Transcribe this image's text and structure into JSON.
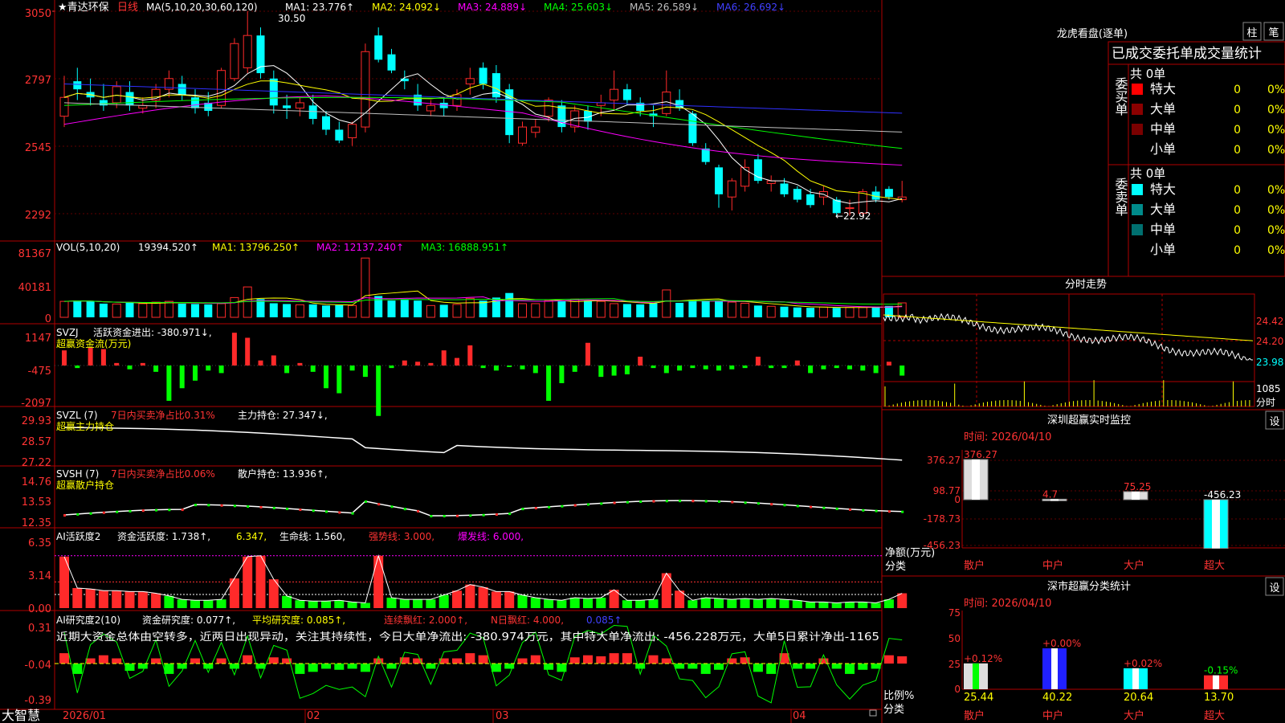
{
  "stock": {
    "name": "★青达环保",
    "period": "日线",
    "ma_header": "MA(5,10,20,30,60,120)",
    "ma": [
      {
        "label": "MA1: 23.776↑",
        "color": "#ffffff"
      },
      {
        "label": "MA2: 24.092↓",
        "color": "#ffff00"
      },
      {
        "label": "MA3: 24.889↓",
        "color": "#ff00ff"
      },
      {
        "label": "MA4: 25.603↓",
        "color": "#00ff00"
      },
      {
        "label": "MA5: 26.589↓",
        "color": "#c0c0c0"
      },
      {
        "label": "MA6: 26.692↓",
        "color": "#0000ff"
      }
    ],
    "high_mark": "30.50",
    "low_mark": "←22.92",
    "y_ticks": [
      "3050",
      "2797",
      "2545",
      "2292"
    ]
  },
  "volume": {
    "header": "VOL(5,10,20)",
    "value": "19394.520↑",
    "ma": [
      {
        "label": "MA1: 13796.250↑",
        "color": "#ffff00"
      },
      {
        "label": "MA2: 12137.240↑",
        "color": "#ff00ff"
      },
      {
        "label": "MA3: 16888.951↑",
        "color": "#00ff00"
      }
    ],
    "y_ticks": [
      "81367",
      "40181",
      "0"
    ]
  },
  "svzj": {
    "header": "SVZJ",
    "text": "活跃资金进出: -380.971↓,",
    "subtitle": "超赢资金流(万元)",
    "y_ticks": [
      "1147",
      "-475",
      "-2097"
    ]
  },
  "svzl": {
    "header": "SVZL (7)",
    "text1": "7日内买卖净占比0.31%",
    "text2": "主力持仓: 27.347↓,",
    "subtitle": "超赢主力持仓",
    "y_ticks": [
      "29.93",
      "28.57",
      "27.22"
    ]
  },
  "svsh": {
    "header": "SVSH (7)",
    "text1": "7日内买卖净占比0.06%",
    "text2": "散户持仓: 13.936↑,",
    "subtitle": "超赢散户持仓",
    "y_ticks": [
      "14.76",
      "13.53",
      "12.35"
    ]
  },
  "ai_active": {
    "header": "AI活跃度2",
    "t1": "资金活跃度: 1.738↑,",
    "t2": "6.347,",
    "t3": "生命线: 1.560,",
    "t4": "强势线: 3.000,",
    "t5": "爆发线: 6.000,",
    "y_ticks": [
      "6.35",
      "3.14",
      "0.00"
    ]
  },
  "ai_research": {
    "header": "AI研究度2(10)",
    "t1": "资金研究度: 0.077↑,",
    "t2": "平均研究度: 0.085↑,",
    "t3": "连续飘红: 2.000↑,",
    "t4": "N日飘红: 4.000,",
    "t5": "0.085↑",
    "comment": "近期大资金总体由空转多，近两日出现异动，关注其持续性，今日大单净流出: -380.974万元，其中特大单净流出: -456.228万元，大单5日累计净出-1165",
    "y_ticks": [
      "0.31",
      "-0.04",
      "-0.39"
    ]
  },
  "date_axis": {
    "brand": "大智慧",
    "labels": [
      "2026/01",
      "02",
      "03",
      "04"
    ]
  },
  "right": {
    "lhkp_title": "龙虎看盘(逐单)",
    "tab1": "柱",
    "tab2": "笔",
    "order_header": "已成交委托单成交量统计",
    "buy_label": "委买单",
    "sell_label": "委卖单",
    "buy_total": "共 0单",
    "sell_total": "共 0单",
    "buy_rows": [
      {
        "label": "特大",
        "count": "0",
        "pct": "0%",
        "color": "#ff0000"
      },
      {
        "label": "大单",
        "count": "0",
        "pct": "0%",
        "color": "#8b0000"
      },
      {
        "label": "中单",
        "count": "0",
        "pct": "0%",
        "color": "#7a0000"
      },
      {
        "label": "小单",
        "count": "0",
        "pct": "0%",
        "color": "#000000"
      }
    ],
    "sell_rows": [
      {
        "label": "特大",
        "count": "0",
        "pct": "0%",
        "color": "#00ffff"
      },
      {
        "label": "大单",
        "count": "0",
        "pct": "0%",
        "color": "#008b8b"
      },
      {
        "label": "中单",
        "count": "0",
        "pct": "0%",
        "color": "#007070"
      },
      {
        "label": "小单",
        "count": "0",
        "pct": "0%",
        "color": "#000000"
      }
    ],
    "intraday_title": "分时走势",
    "intraday_prices": [
      "24.42",
      "24.20",
      "23.98"
    ],
    "intraday_vol": "1085",
    "intraday_unit": "分时",
    "sz_title": "深圳超赢实时监控",
    "settings": "设",
    "sz_date": "时间: 2026/04/10",
    "sz_y_ticks": [
      "376.27",
      "98.77",
      "0",
      "-178.73",
      "-456.23"
    ],
    "sz_ylabel1": "净额(万元)",
    "sz_ylabel2": "分类",
    "sz_bars": [
      {
        "cat": "散户",
        "value": 376.27,
        "label": "376.27"
      },
      {
        "cat": "中户",
        "value": 4.7,
        "label": "4.7"
      },
      {
        "cat": "大户",
        "value": 75.25,
        "label": "75.25"
      },
      {
        "cat": "超大",
        "value": -456.23,
        "label": "-456.23"
      }
    ],
    "cls_title": "深市超赢分类统计",
    "cls_date": "时间: 2026/04/10",
    "cls_y_ticks": [
      "75",
      "50",
      "25",
      "0"
    ],
    "cls_ylabel1": "比例%",
    "cls_ylabel2": "分类",
    "cls_bars": [
      {
        "cat": "散户",
        "value": 25.44,
        "label": "25.44",
        "chg": "+0.12%"
      },
      {
        "cat": "中户",
        "value": 40.22,
        "label": "40.22",
        "chg": "+0.00%"
      },
      {
        "cat": "大户",
        "value": 20.64,
        "label": "20.64",
        "chg": "+0.02%"
      },
      {
        "cat": "超大",
        "value": 13.7,
        "label": "13.70",
        "chg": "-0.15%"
      }
    ]
  },
  "chart_data": [
    {
      "type": "candlestick",
      "title": "青达环保 日线",
      "ylim": [
        22.92,
        30.5
      ],
      "ohlc": [
        [
          26.6,
          28.1,
          26.2,
          27.3
        ],
        [
          27.9,
          28.4,
          27.2,
          27.6
        ],
        [
          27.5,
          28.0,
          27.0,
          27.3
        ],
        [
          27.2,
          27.8,
          26.8,
          27.0
        ],
        [
          27.1,
          27.9,
          26.9,
          27.7
        ],
        [
          27.5,
          27.9,
          26.8,
          27.0
        ],
        [
          26.9,
          27.3,
          26.7,
          27.0
        ],
        [
          27.2,
          27.8,
          26.9,
          27.6
        ],
        [
          27.6,
          28.3,
          27.3,
          28.0
        ],
        [
          27.8,
          28.1,
          27.2,
          27.4
        ],
        [
          27.3,
          27.6,
          26.7,
          26.9
        ],
        [
          27.1,
          27.5,
          26.6,
          26.8
        ],
        [
          27.0,
          28.4,
          26.9,
          28.3
        ],
        [
          28.0,
          29.5,
          27.9,
          29.3
        ],
        [
          28.4,
          30.5,
          28.2,
          29.6
        ],
        [
          29.6,
          29.9,
          28.0,
          28.2
        ],
        [
          28.0,
          28.3,
          26.7,
          27.0
        ],
        [
          27.0,
          27.4,
          26.5,
          26.9
        ],
        [
          26.9,
          27.3,
          26.6,
          27.1
        ],
        [
          27.0,
          27.4,
          26.3,
          26.5
        ],
        [
          26.6,
          26.8,
          25.9,
          26.1
        ],
        [
          26.1,
          26.4,
          25.6,
          25.7
        ],
        [
          25.8,
          26.4,
          25.5,
          26.3
        ],
        [
          26.2,
          29.3,
          26.0,
          29.0
        ],
        [
          29.6,
          29.9,
          28.6,
          28.7
        ],
        [
          28.9,
          29.1,
          28.2,
          28.3
        ],
        [
          28.0,
          28.3,
          27.6,
          27.9
        ],
        [
          27.4,
          27.8,
          26.8,
          27.0
        ],
        [
          26.8,
          27.2,
          26.6,
          27.0
        ],
        [
          27.1,
          27.3,
          26.6,
          26.9
        ],
        [
          27.0,
          27.6,
          26.8,
          27.4
        ],
        [
          27.8,
          28.4,
          27.4,
          28.0
        ],
        [
          28.4,
          28.6,
          27.6,
          27.8
        ],
        [
          28.2,
          28.5,
          27.1,
          27.3
        ],
        [
          27.6,
          27.8,
          25.6,
          25.9
        ],
        [
          25.6,
          26.4,
          25.5,
          26.2
        ],
        [
          26.0,
          26.5,
          25.8,
          26.2
        ],
        [
          26.6,
          27.3,
          26.4,
          27.2
        ],
        [
          27.0,
          27.2,
          26.0,
          26.2
        ],
        [
          26.2,
          27.0,
          26.0,
          26.8
        ],
        [
          26.8,
          27.0,
          26.1,
          26.4
        ],
        [
          27.0,
          27.4,
          26.6,
          27.1
        ],
        [
          27.2,
          28.3,
          26.8,
          27.6
        ],
        [
          27.6,
          27.8,
          27.0,
          27.2
        ],
        [
          27.1,
          27.3,
          26.6,
          26.8
        ],
        [
          26.7,
          27.0,
          26.2,
          26.6
        ],
        [
          26.7,
          28.3,
          26.6,
          27.5
        ],
        [
          27.2,
          27.6,
          26.8,
          26.9
        ],
        [
          26.7,
          26.8,
          25.5,
          25.6
        ],
        [
          25.4,
          25.6,
          24.8,
          24.9
        ],
        [
          24.7,
          24.8,
          23.2,
          23.7
        ],
        [
          23.6,
          24.3,
          23.1,
          24.2
        ],
        [
          24.0,
          25.0,
          23.8,
          24.7
        ],
        [
          25.0,
          25.2,
          24.1,
          24.2
        ],
        [
          24.1,
          24.4,
          23.8,
          24.2
        ],
        [
          24.1,
          24.3,
          23.6,
          23.7
        ],
        [
          23.9,
          24.0,
          23.4,
          23.5
        ],
        [
          23.7,
          23.9,
          23.2,
          23.3
        ],
        [
          23.6,
          24.0,
          23.3,
          23.8
        ],
        [
          23.5,
          23.6,
          22.9,
          23.0
        ],
        [
          23.2,
          23.5,
          22.9,
          23.2
        ],
        [
          23.0,
          23.9,
          22.9,
          23.8
        ],
        [
          23.8,
          24.0,
          23.4,
          23.5
        ],
        [
          23.9,
          24.0,
          23.5,
          23.6
        ],
        [
          23.5,
          24.2,
          23.4,
          23.6
        ]
      ]
    },
    {
      "type": "bar",
      "title": "VOL",
      "values": [
        21000,
        22000,
        21000,
        18000,
        17500,
        19000,
        18000,
        20000,
        21000,
        18000,
        17500,
        17000,
        18000,
        26000,
        40000,
        24000,
        18500,
        17500,
        16500,
        17000,
        15500,
        16000,
        15500,
        78000,
        28000,
        22000,
        23000,
        22000,
        15500,
        16500,
        17000,
        25000,
        22000,
        26000,
        32000,
        18000,
        18000,
        22000,
        21000,
        24000,
        22000,
        21000,
        18000,
        17500,
        17000,
        18500,
        36000,
        19000,
        23000,
        22000,
        21000,
        20000,
        18500,
        15500,
        14500,
        14000,
        13000,
        12500,
        13500,
        12500,
        13000,
        13000,
        14000,
        15000,
        19000
      ]
    },
    {
      "type": "bar",
      "title": "超赢资金流(万元)",
      "values": [
        600,
        -100,
        700,
        650,
        100,
        -150,
        100,
        -250,
        -1400,
        -900,
        -600,
        -200,
        -300,
        1300,
        1100,
        200,
        400,
        -300,
        100,
        -250,
        -900,
        -1100,
        -200,
        -450,
        -2000,
        -100,
        200,
        150,
        100,
        600,
        300,
        800,
        -100,
        -200,
        -50,
        -150,
        -300,
        -1400,
        -700,
        -250,
        900,
        -450,
        -400,
        -350,
        350,
        -100,
        -300,
        -200,
        -100,
        -150,
        -200,
        -150,
        -100,
        350,
        -100,
        -100,
        200,
        -300,
        -150,
        -100,
        -150,
        -200,
        -300,
        150,
        -400
      ]
    },
    {
      "type": "line",
      "title": "超赢主力持仓",
      "ylim": [
        27.22,
        29.93
      ]
    },
    {
      "type": "line",
      "title": "超赢散户持仓",
      "ylim": [
        12.35,
        14.76
      ]
    },
    {
      "type": "bar",
      "title": "AI活跃度2",
      "values": [
        5.9,
        2.3,
        2.2,
        2.0,
        2.0,
        1.9,
        1.9,
        1.7,
        1.4,
        1.0,
        0.9,
        0.9,
        1.0,
        3.4,
        5.9,
        6.0,
        3.3,
        1.4,
        0.9,
        0.8,
        0.8,
        0.9,
        0.7,
        0.6,
        6.0,
        1.2,
        1.0,
        1.0,
        1.0,
        1.5,
        2.0,
        2.7,
        2.4,
        1.9,
        1.9,
        1.5,
        1.2,
        1.0,
        0.9,
        1.2,
        1.1,
        1.2,
        2.1,
        0.9,
        0.9,
        1.0,
        4.0,
        2.0,
        0.9,
        1.2,
        1.1,
        1.0,
        1.1,
        1.0,
        1.1,
        1.0,
        0.9,
        0.7,
        0.7,
        0.6,
        0.7,
        0.7,
        0.6,
        1.0,
        1.7
      ]
    },
    {
      "type": "bar",
      "title": "AI研究度2(10)",
      "values": [
        0.1,
        -0.1,
        0.05,
        0.08,
        0.05,
        -0.07,
        -0.05,
        0.05,
        -0.1,
        -0.05,
        0.05,
        -0.05,
        0.05,
        -0.05,
        0.08,
        -0.05,
        0.06,
        0.05,
        -0.1,
        -0.08,
        -0.05,
        -0.06,
        -0.05,
        -0.08,
        0.05,
        -0.05,
        0.06,
        0.05,
        -0.05,
        0.05,
        0.05,
        0.1,
        0.08,
        -0.08,
        -0.05,
        0.05,
        0.08,
        -0.06,
        -0.08,
        0.06,
        0.08,
        0.07,
        0.1,
        0.1,
        -0.05,
        0.08,
        0.05,
        -0.05,
        -0.05,
        -0.1,
        -0.06,
        0.05,
        0.06,
        -0.08,
        -0.1,
        0.1,
        -0.05,
        -0.05,
        0.05,
        -0.05,
        -0.1,
        -0.06,
        -0.05,
        0.08,
        0.07
      ]
    },
    {
      "type": "bar",
      "title": "深圳超赢实时监控",
      "categories": [
        "散户",
        "中户",
        "大户",
        "超大"
      ],
      "values": [
        376.27,
        4.7,
        75.25,
        -456.23
      ],
      "ylabel": "净额(万元)"
    },
    {
      "type": "bar",
      "title": "深市超赢分类统计",
      "categories": [
        "散户",
        "中户",
        "大户",
        "超大"
      ],
      "values": [
        25.44,
        40.22,
        20.64,
        13.7
      ],
      "ylabel": "比例%"
    }
  ]
}
